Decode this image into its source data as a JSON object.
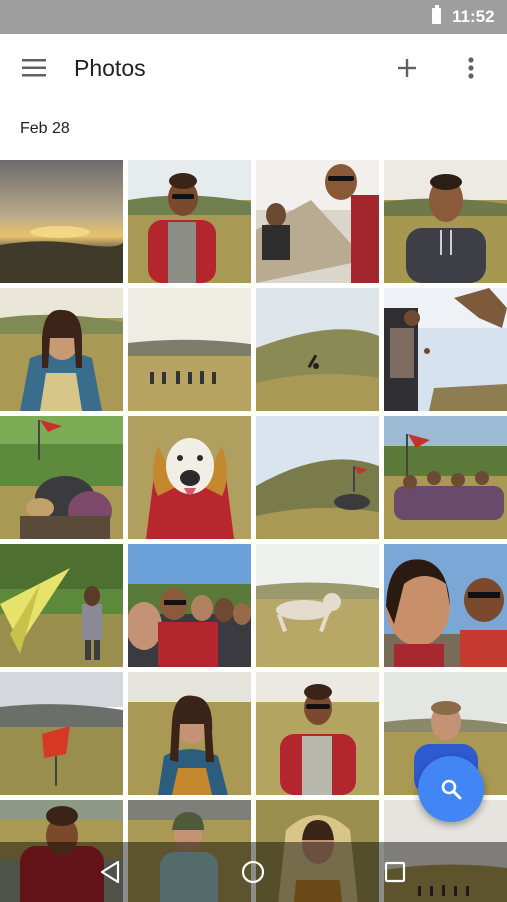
{
  "status_bar": {
    "time": "11:52",
    "battery_icon": "battery-icon"
  },
  "app_bar": {
    "menu_icon": "hamburger-menu-icon",
    "title": "Photos",
    "add_icon": "plus-icon",
    "more_icon": "more-vert-icon"
  },
  "date_header": "Feb 28",
  "photos": [
    {
      "name": "photo-sunset-landscape"
    },
    {
      "name": "photo-man-sunglasses-field"
    },
    {
      "name": "photo-couple-selfie-tent"
    },
    {
      "name": "photo-man-hoodie-field"
    },
    {
      "name": "photo-woman-blanket"
    },
    {
      "name": "photo-people-hill-distance"
    },
    {
      "name": "photo-hill-cartwheel"
    },
    {
      "name": "photo-people-jumping-sky"
    },
    {
      "name": "photo-group-flag-dog"
    },
    {
      "name": "photo-dog-in-blanket"
    },
    {
      "name": "photo-hill-group-flag"
    },
    {
      "name": "photo-group-sitting-flag"
    },
    {
      "name": "photo-woman-kite"
    },
    {
      "name": "photo-group-selfie"
    },
    {
      "name": "photo-dog-running"
    },
    {
      "name": "photo-couple-closeup-selfie"
    },
    {
      "name": "photo-red-kite-field"
    },
    {
      "name": "photo-woman-field-laughing"
    },
    {
      "name": "photo-man-shirt-field"
    },
    {
      "name": "photo-man-blue-shirt"
    },
    {
      "name": "photo-man-plaid-shirt"
    },
    {
      "name": "photo-woman-beanie"
    },
    {
      "name": "photo-woman-hooded-blanket"
    },
    {
      "name": "photo-group-distance-hill"
    }
  ],
  "fab": {
    "icon": "search-icon",
    "color": "#4285f4"
  },
  "nav_bar": {
    "back_icon": "back-triangle-icon",
    "home_icon": "home-circle-icon",
    "recents_icon": "recents-square-icon"
  }
}
